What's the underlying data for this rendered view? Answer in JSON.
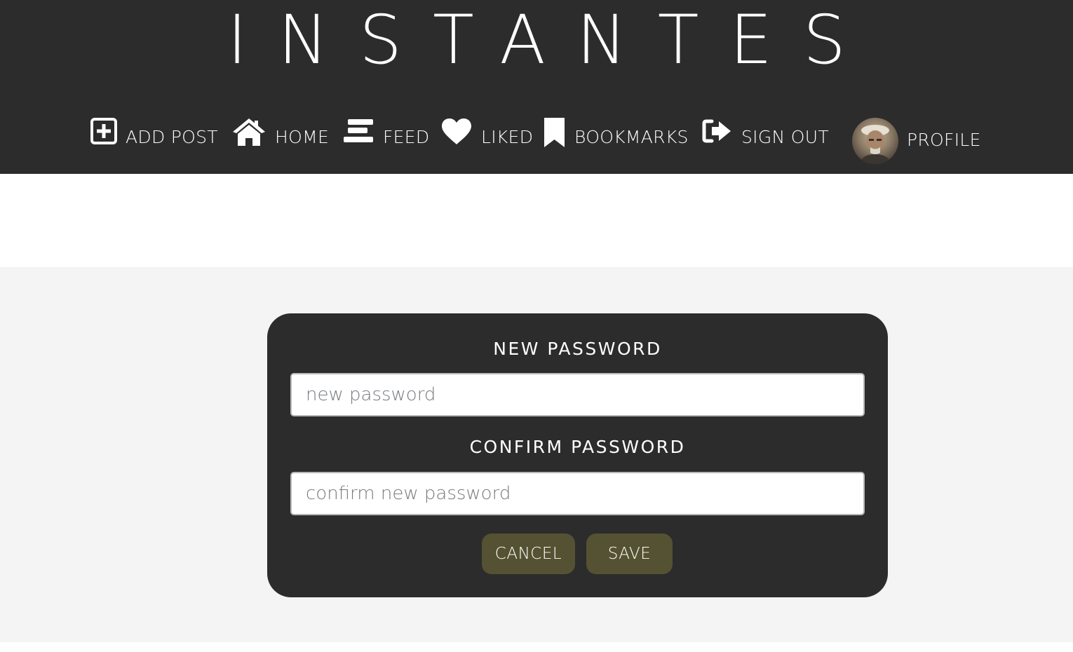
{
  "app": {
    "title": "INSTANTES"
  },
  "nav": {
    "items": [
      {
        "label": "ADD POST",
        "icon": "plus-square-icon"
      },
      {
        "label": "HOME",
        "icon": "home-icon"
      },
      {
        "label": "FEED",
        "icon": "feed-icon"
      },
      {
        "label": "LIKED",
        "icon": "heart-icon"
      },
      {
        "label": "BOOKMARKS",
        "icon": "bookmark-icon"
      },
      {
        "label": "SIGN OUT",
        "icon": "sign-out-icon"
      }
    ],
    "profile": {
      "label": "PROFILE",
      "icon": "avatar"
    }
  },
  "form": {
    "new_password": {
      "label": "NEW PASSWORD",
      "placeholder": "new password",
      "value": ""
    },
    "confirm_password": {
      "label": "CONFIRM PASSWORD",
      "placeholder": "confirm new password",
      "value": ""
    },
    "cancel_label": "CANCEL",
    "save_label": "SAVE"
  },
  "colors": {
    "header_bg": "#2c2c2c",
    "card_bg": "#2c2c2c",
    "page_bg": "#f4f4f4",
    "button_bg": "#545232",
    "text_light": "#ffffff"
  }
}
